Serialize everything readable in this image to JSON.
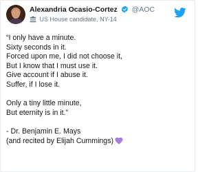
{
  "author": {
    "display_name": "Alexandria Ocasio-Cortez",
    "handle": "@AOC",
    "label": "US House candidate, NY-14",
    "verified_icon": "verified-badge-icon",
    "label_icon": "government-building-icon"
  },
  "brand": {
    "icon": "twitter-bird-icon",
    "color": "#1da1f2"
  },
  "tweet": {
    "lines": [
      "“I only have a minute.",
      "Sixty seconds in it.",
      "Forced upon me, I did not choose it,",
      "But I know that I must use it.",
      "Give account if I abuse it.",
      "Suffer, if I lose it."
    ],
    "lines2": [
      "Only a tiny little minute,",
      "But eternity is in it.”"
    ],
    "attribution": [
      "- Dr. Benjamin E. Mays",
      "(and recited by Elijah Cummings)"
    ],
    "emoji": "purple-heart-icon",
    "emoji_color": "#a57fe0"
  },
  "colors": {
    "text": "#14171a",
    "muted": "#657786",
    "verified": "#1da1f2"
  }
}
